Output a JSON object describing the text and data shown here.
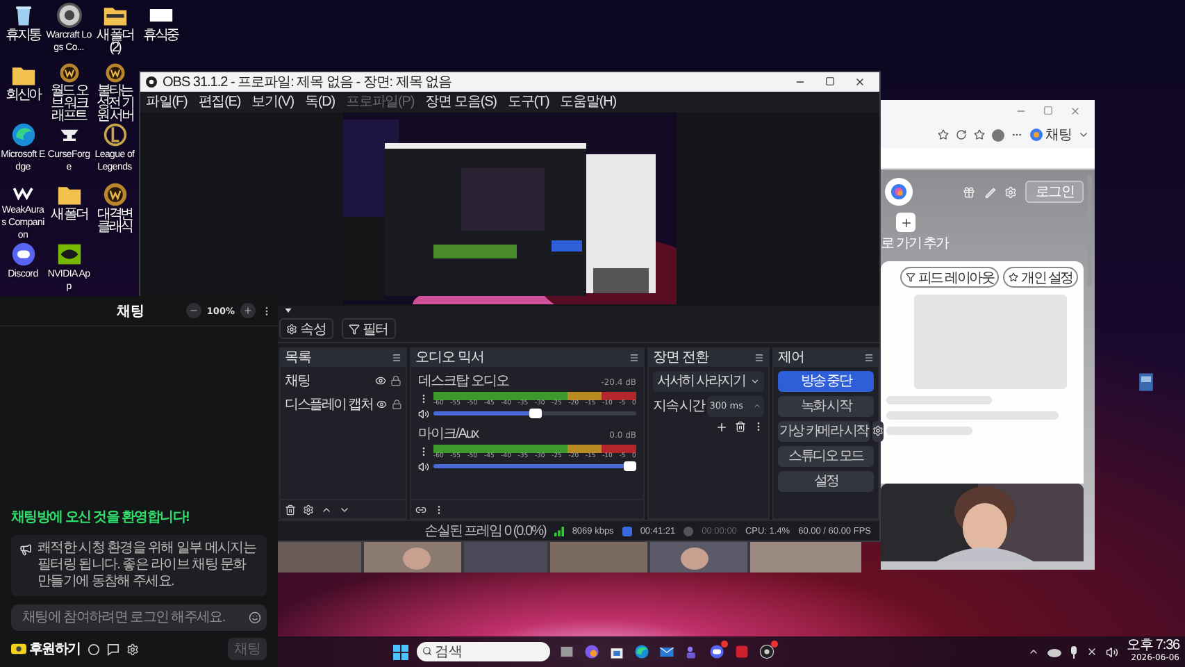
{
  "desktop_icon_columns": [
    {
      "icons": [
        {
          "label": "휴지통"
        },
        {
          "label": "회신아"
        },
        {
          "label": "Microsoft Edge"
        },
        {
          "label": "WeakAuras Companion"
        },
        {
          "label": "Discord"
        }
      ]
    },
    {
      "icons": [
        {
          "label": "Warcraft Logs Co..."
        },
        {
          "label": "월드 오브 워크래프트"
        },
        {
          "label": "CurseForge"
        },
        {
          "label": "새 폴더"
        },
        {
          "label": "NVIDIA App"
        }
      ]
    },
    {
      "icons": [
        {
          "label": "새 폴더 (2)"
        },
        {
          "label": "불타는 성전 기원 서버"
        },
        {
          "label": "League of Legends"
        },
        {
          "label": "대격변 클래식"
        }
      ]
    },
    {
      "icons": [
        {
          "label": "휴식중"
        }
      ]
    }
  ],
  "obs": {
    "title": "OBS 31.1.2 - 프로파일: 제목 없음 - 장면: 제목 없음",
    "menu": [
      {
        "label": "파일(F)",
        "disabled": false
      },
      {
        "label": "편집(E)",
        "disabled": false
      },
      {
        "label": "보기(V)",
        "disabled": false
      },
      {
        "label": "독(D)",
        "disabled": false
      },
      {
        "label": "프로파일(P)",
        "disabled": true
      },
      {
        "label": "장면 모음(S)",
        "disabled": false
      },
      {
        "label": "도구(T)",
        "disabled": false
      },
      {
        "label": "도움말(H)",
        "disabled": false
      }
    ],
    "toolbar": [
      {
        "label": "속성",
        "kind": "gear"
      },
      {
        "label": "필터",
        "kind": "filter"
      }
    ],
    "sources": {
      "title": "목록",
      "items": [
        {
          "name": "채팅"
        },
        {
          "name": "디스플레이 캡처"
        }
      ]
    },
    "mixer": {
      "title": "오디오 믹서",
      "channels": [
        {
          "name": "데스크탑 오디오",
          "reading": "-20.4 dB",
          "level": 0.5,
          "ticks": [
            "-60",
            "-55",
            "-50",
            "-45",
            "-40",
            "-35",
            "-30",
            "-25",
            "-20",
            "-15",
            "-10",
            "-5",
            "0"
          ]
        },
        {
          "name": "마이크/Aux",
          "reading": "0.0 dB",
          "level": 1,
          "ticks": [
            "-60",
            "-55",
            "-50",
            "-45",
            "-40",
            "-35",
            "-30",
            "-25",
            "-20",
            "-15",
            "-10",
            "-5",
            "0"
          ]
        }
      ]
    },
    "transitions": {
      "title": "장면 전환",
      "selected": "서서히 사라지기",
      "duration_label": "지속 시간",
      "duration": "300 ms"
    },
    "controls": {
      "title": "제어",
      "buttons": [
        {
          "label": "방송 중단",
          "active": true,
          "kind": "plain"
        },
        {
          "label": "녹화 시작",
          "active": false,
          "kind": "plain"
        },
        {
          "label": "가상 카메라 시작",
          "active": false,
          "kind": "split"
        },
        {
          "label": "스튜디오 모드",
          "active": false,
          "kind": "plain"
        },
        {
          "label": "설정",
          "active": false,
          "kind": "plain"
        }
      ]
    },
    "status_bar": {
      "dropped_frames": "손실된 프레임 0 (0.0%)",
      "bitrate": "8069 kbps",
      "stream_time": "00:41:21",
      "record_time": "00:00:00",
      "cpu": "CPU: 1.4%",
      "fps": "60.00 / 60.00 FPS"
    }
  },
  "chat": {
    "title": "채팅",
    "zoom": "100%",
    "welcome": "채팅방에 오신 것을 환영합니다!",
    "notice": "쾌적한 시청 환경을 위해 일부 메시지는 필터링 됩니다. 좋은 라이브 채팅 문화 만들기에 동참해 주세요.",
    "input": {
      "placeholder": "채팅에 참여하려면 로그인 해주세요."
    },
    "donate": "후원하기",
    "send": "채팅",
    "send_disabled": true
  },
  "browser": {
    "profile_label": "채팅",
    "login": "로그인",
    "shortcut_label": "로 가기 추가",
    "feed_buttons": [
      {
        "label": "피드 레이아웃",
        "kind": "layout"
      },
      {
        "label": "개인 설정",
        "kind": "personal"
      }
    ]
  },
  "taskbar": {
    "search": {
      "placeholder": "검색"
    },
    "time": "오후 7:36",
    "date": "2026-06-06"
  }
}
